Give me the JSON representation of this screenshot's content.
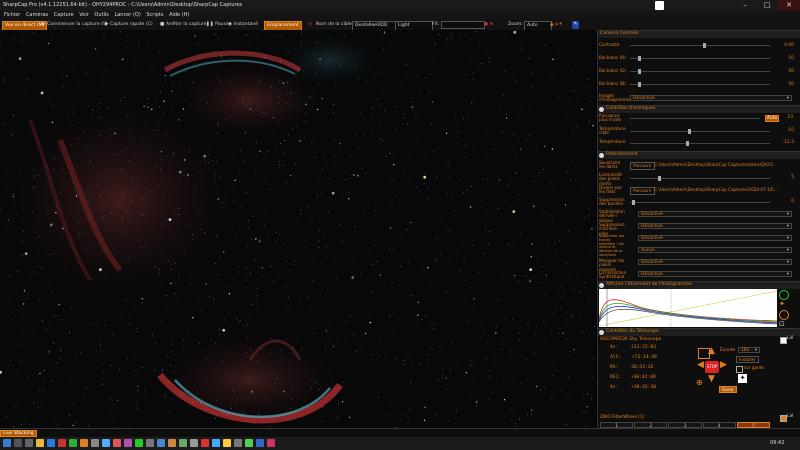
{
  "app": {
    "title": "SharpCap Pro (v4.1.12251.64-bit) - QHY294PROC - C:\\Users\\Admin\\Desktop\\SharpCap Captures"
  },
  "menu": [
    "Fichier",
    "Caméras",
    "Capture",
    "Voir",
    "Outils",
    "Lancer (Q)",
    "Scripts",
    "Aide (H)"
  ],
  "toolbar": {
    "live_stack": "Vue en direct (M)",
    "start_capture": "Commencer la capture (S)",
    "quick_capture": "Capture rapide (C)",
    "stop_capture": "Arrêter la capture",
    "pause": "Pause",
    "snapshot": "Instantané",
    "preview": "Emplacement",
    "target_label": "Nom de la cible",
    "target_value": "DentelleeVDO",
    "frame_type": "Light",
    "fx_label": "FX:",
    "zoom_label": "Zoom:",
    "zoom_value": "Auto"
  },
  "panel": {
    "camera_controls": {
      "title": "Camera Controls",
      "rows": [
        {
          "label": "Contraste",
          "value": "0.00"
        },
        {
          "label": "Bal blanc (R)",
          "value": "50"
        },
        {
          "label": "Bal blanc (G)",
          "value": "50"
        },
        {
          "label": "Bal blanc (B)",
          "value": "50"
        }
      ],
      "image_label": "Images d'histogramme",
      "image_value": "Désactivé"
    },
    "thermal": {
      "title": "Contrôles thermiques",
      "rows": [
        {
          "label": "Puissance plus froide",
          "value": "23",
          "auto": "Auto"
        },
        {
          "label": "Température cible",
          "value": "-10"
        },
        {
          "label": "Température",
          "value": "-12.3"
        }
      ]
    },
    "preprocessing": {
      "title": "Prétraitement",
      "rows": [
        {
          "label": "Soustraire les darks",
          "button": "Parcourir",
          "path": "C:\\Users\\Admin\\Desktop\\SharpCap Captures\\darks\\QHY2..."
        },
        {
          "label": "Luminosité des pixels morts",
          "value": "5"
        },
        {
          "label": "Diviser par les flats",
          "button": "Parcourir",
          "path": "C:\\Users\\Admin\\Desktop\\SharpCap Captures\\2024-07-14\\..."
        },
        {
          "label": "Suppression des bandes",
          "value": "0"
        },
        {
          "label": "Stabilisation dérivée / disque",
          "dd": "Désactivé"
        },
        {
          "label": "Suppression d'arrière-plan",
          "dd": "Désactivé"
        },
        {
          "label": "Supprimer les traces satellites / les avions et dérives de la vitre/cam",
          "dd": "Désactivé"
        },
        {
          "label": "Masquer les pixels exposés",
          "dd": "Aucun"
        },
        {
          "label": "La correction Synthétique",
          "dd": "Désactivé"
        },
        {
          "label": "Flat",
          "dd": "Désactivé"
        }
      ]
    },
    "histogram": {
      "title": "Afficher l'étirement de l'histogramme"
    },
    "telescope": {
      "title": "Contrôles du Télescope",
      "device": "ASCOM/EQ6 Sky Telescope",
      "checkbox": "Lié",
      "coords": [
        {
          "k": "Az:",
          "v": "213:22:03"
        },
        {
          "k": "Alt:",
          "v": "+73:14:49"
        },
        {
          "k": "RA:",
          "v": "20:53:26"
        },
        {
          "k": "DEC:",
          "v": "+30:42:09"
        },
        {
          "k": "Az:",
          "v": "+30:42:30"
        }
      ],
      "speed_label": "Écoute",
      "speed_value": "16x",
      "install_btn": "Installer",
      "guide_check": "sur garde",
      "stop_btn": "STOP",
      "park_btn": "Garer"
    },
    "filterwheel": {
      "title": "ZWO FilterWheel (1)",
      "check": "Lié",
      "slots": [
        "1",
        "2",
        "3",
        "4",
        "5"
      ],
      "install": "Installer",
      "remarks": "Remarques"
    }
  },
  "status": {
    "text": "Live Stacking"
  },
  "taskbar": {
    "time": "09:42"
  },
  "colors": {
    "accent": "#e08020",
    "bg": "#000000"
  }
}
